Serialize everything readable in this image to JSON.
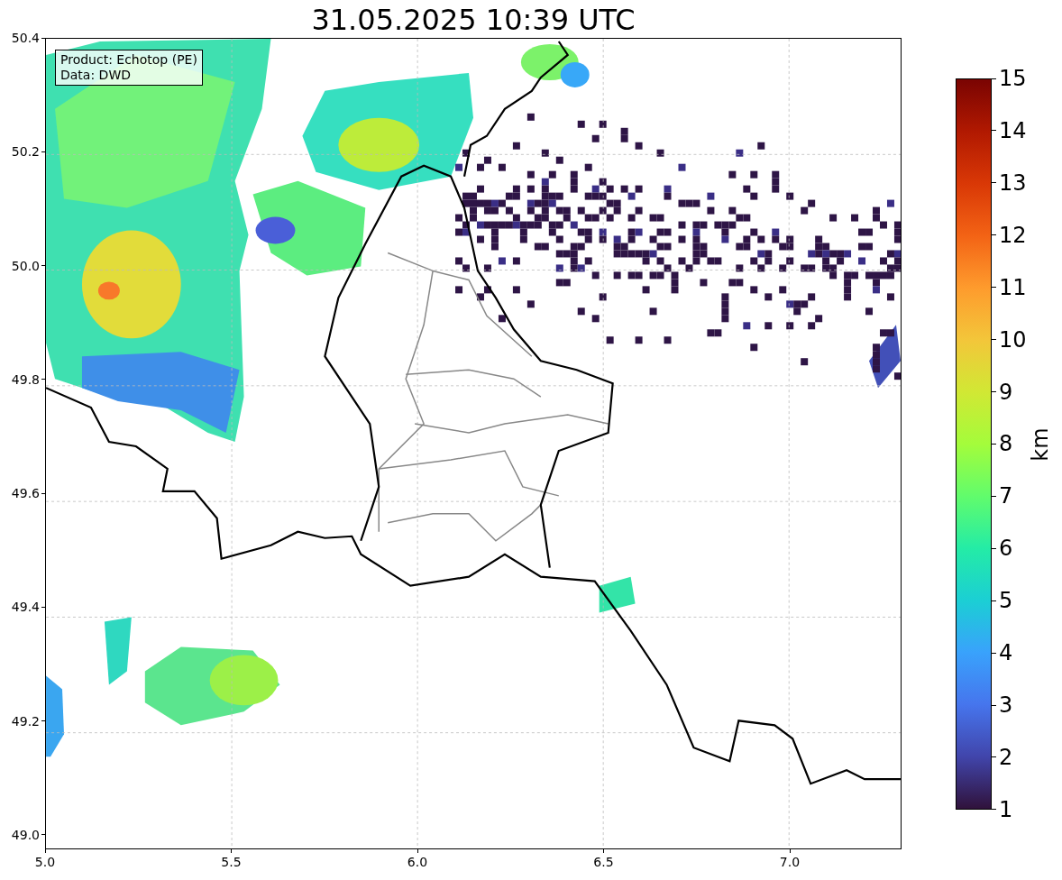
{
  "title": "31.05.2025 10:39 UTC",
  "info_box": {
    "lines": [
      "Product: Echotop (PE)",
      "Data: DWD"
    ]
  },
  "y_ticks": [
    "50.4",
    "50.2",
    "50.0",
    "49.8",
    "49.6",
    "49.4",
    "49.2",
    "49.0"
  ],
  "x_ticks": [
    "5.0",
    "5.5",
    "6.0",
    "6.5",
    "7.0"
  ],
  "colorbar": {
    "label": "km",
    "ticks": [
      "15",
      "14",
      "13",
      "12",
      "11",
      "10",
      "9",
      "8",
      "7",
      "6",
      "5",
      "4",
      "3",
      "2",
      "1"
    ]
  }
}
